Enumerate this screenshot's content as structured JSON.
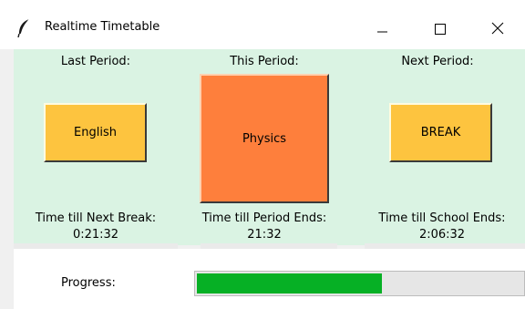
{
  "window": {
    "title": "Realtime Timetable",
    "icon": "feather-icon",
    "controls": [
      "minimize-icon",
      "maximize-icon",
      "close-icon"
    ]
  },
  "periods": {
    "last": {
      "heading": "Last Period:",
      "subject": "English",
      "color": "#fdc43f"
    },
    "this": {
      "heading": "This Period:",
      "subject": "Physics",
      "color": "#fe7f3c"
    },
    "next": {
      "heading": "Next Period:",
      "subject": "BREAK",
      "color": "#fdc43f"
    }
  },
  "timers": {
    "next_break": {
      "label": "Time till Next Break:",
      "value": "0:21:32"
    },
    "period_end": {
      "label": "Time till Period Ends:",
      "value": "21:32"
    },
    "school_end": {
      "label": "Time till School Ends:",
      "value": "2:06:32"
    }
  },
  "progress": {
    "label": "Progress:",
    "fraction": 0.57,
    "color": "#06b025"
  },
  "colors": {
    "panel_bg": "#daf3e3"
  }
}
